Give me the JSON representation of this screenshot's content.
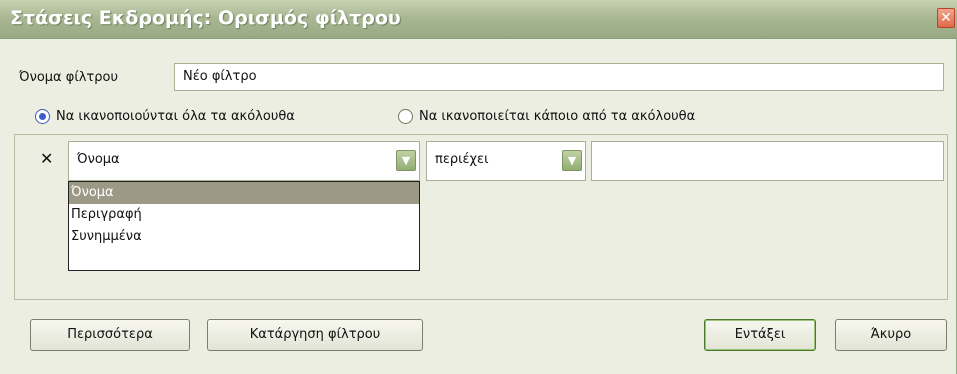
{
  "window": {
    "title": "Στάσεις Εκδρομής: Ορισμός φίλτρου",
    "close_glyph": "✕"
  },
  "filter_name": {
    "label": "Όνομα φίλτρου",
    "value": "Νέο φίλτρο"
  },
  "match_mode": {
    "all_label": "Να ικανοποιούνται όλα τα ακόλουθα",
    "any_label": "Να ικανοποιείται κάποιο από τα ακόλουθα",
    "selected": "all"
  },
  "rule": {
    "remove_glyph": "✕",
    "field_value": "Όνομα",
    "operator_value": "περιέχει",
    "text_value": "",
    "arrow_glyph": "▼"
  },
  "field_options": [
    "Όνομα",
    "Περιγραφή",
    "Συνημμένα"
  ],
  "buttons": {
    "more": "Περισσότερα",
    "remove_filter": "Κατάργηση φίλτρου",
    "ok": "Εντάξει",
    "cancel": "Άκυρο"
  },
  "colors": {
    "titlebar": "#a9b893",
    "accent_radio": "#3d5ec7",
    "selected_option": "#9c9a87"
  }
}
